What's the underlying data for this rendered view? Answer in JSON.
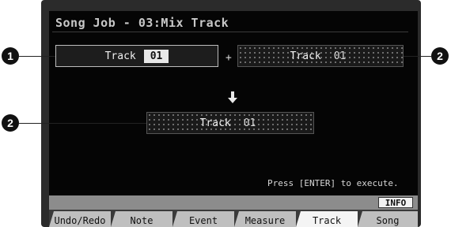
{
  "title": "Song Job - 03:Mix Track",
  "source_a": {
    "label": "Track",
    "value": "01"
  },
  "plus": "+",
  "source_b": {
    "label": "Track",
    "value": "01"
  },
  "destination": {
    "label": "Track",
    "value": "01"
  },
  "hint": "Press [ENTER] to execute.",
  "info_button": "INFO",
  "tabs": [
    {
      "label": "Undo/Redo"
    },
    {
      "label": "Note"
    },
    {
      "label": "Event"
    },
    {
      "label": "Measure"
    },
    {
      "label": "Track",
      "active": true
    },
    {
      "label": "Song"
    }
  ],
  "callouts": {
    "one": "1",
    "two": "2",
    "two_b": "2"
  }
}
